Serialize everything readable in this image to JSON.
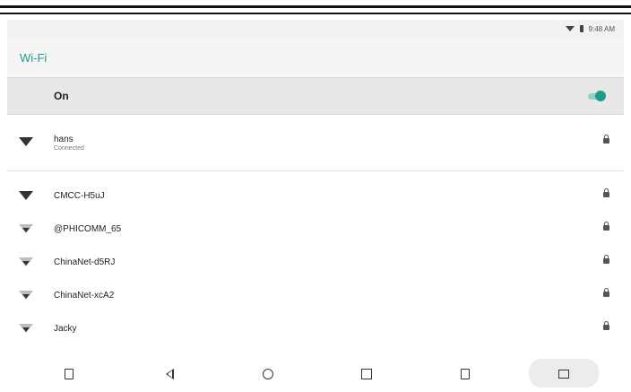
{
  "statusbar": {
    "time": "9:48 AM",
    "icons": [
      "wifi-icon",
      "battery-icon"
    ]
  },
  "header": {
    "title": "Wi-Fi"
  },
  "master": {
    "label": "On",
    "enabled": true,
    "accent": "#1e9a8a"
  },
  "networks": [
    {
      "name": "hans",
      "status": "Connected",
      "secured": true,
      "signal": "strong"
    },
    {
      "name": "CMCC-H5uJ",
      "status": "",
      "secured": true,
      "signal": "strong"
    },
    {
      "name": "@PHICOMM_65",
      "status": "",
      "secured": true,
      "signal": "weak"
    },
    {
      "name": "ChinaNet-d5RJ",
      "status": "",
      "secured": true,
      "signal": "weak"
    },
    {
      "name": "ChinaNet-xcA2",
      "status": "",
      "secured": true,
      "signal": "weak"
    },
    {
      "name": "Jacky",
      "status": "",
      "secured": true,
      "signal": "weak"
    }
  ],
  "navbar": {
    "buttons": [
      "volume-down-icon",
      "back-icon",
      "home-icon",
      "recents-icon",
      "volume-up-icon",
      "screenshot-icon"
    ]
  }
}
